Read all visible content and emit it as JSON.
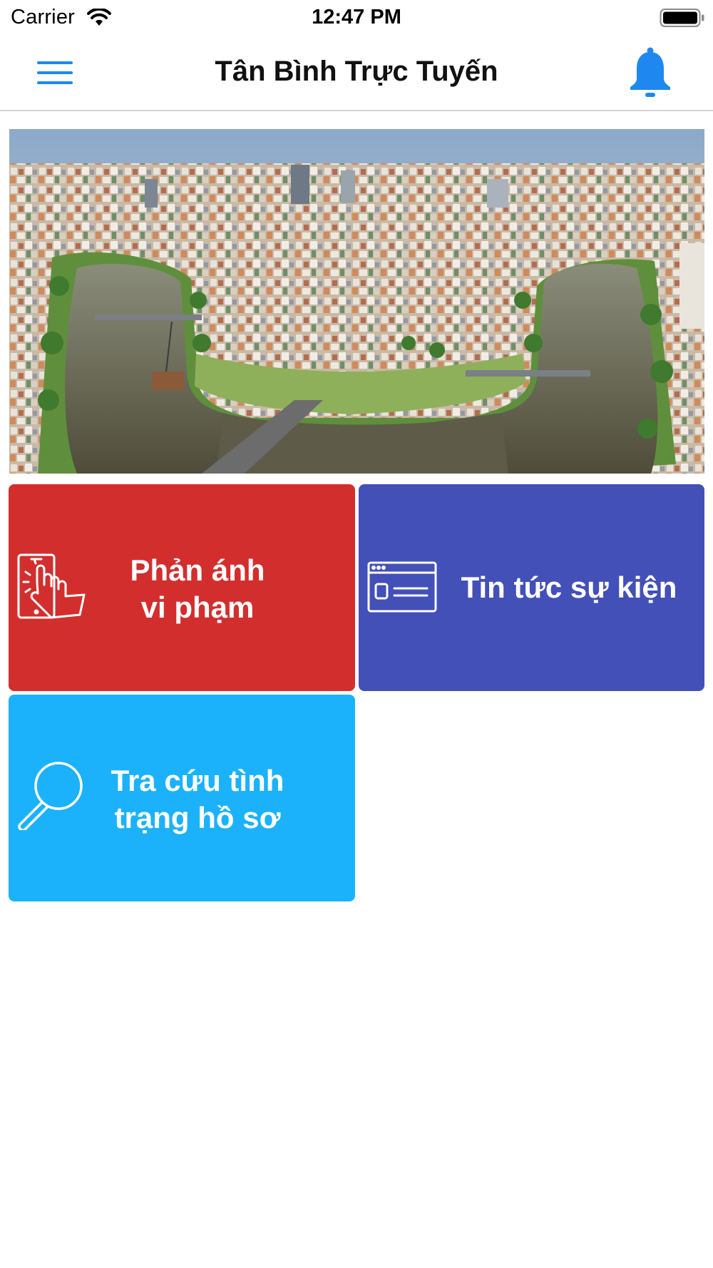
{
  "status_bar": {
    "carrier": "Carrier",
    "time": "12:47 PM",
    "wifi_icon": "wifi-icon",
    "battery_icon": "battery-full-icon"
  },
  "header": {
    "title": "Tân Bình Trực Tuyến",
    "menu_icon": "hamburger-menu-icon",
    "notification_icon": "bell-icon",
    "accent_color": "#1e88f0"
  },
  "banner": {
    "description_icon": "city-river-photo"
  },
  "tiles": [
    {
      "label": "Phản ánh\nvi phạm",
      "icon": "touch-phone-icon",
      "color": "#d32e2e"
    },
    {
      "label": "Tin tức sự kiện",
      "icon": "browser-window-icon",
      "color": "#4350b8"
    },
    {
      "label": "Tra cứu tình\ntrạng hồ sơ",
      "icon": "magnifier-icon",
      "color": "#1bb2fb"
    }
  ]
}
